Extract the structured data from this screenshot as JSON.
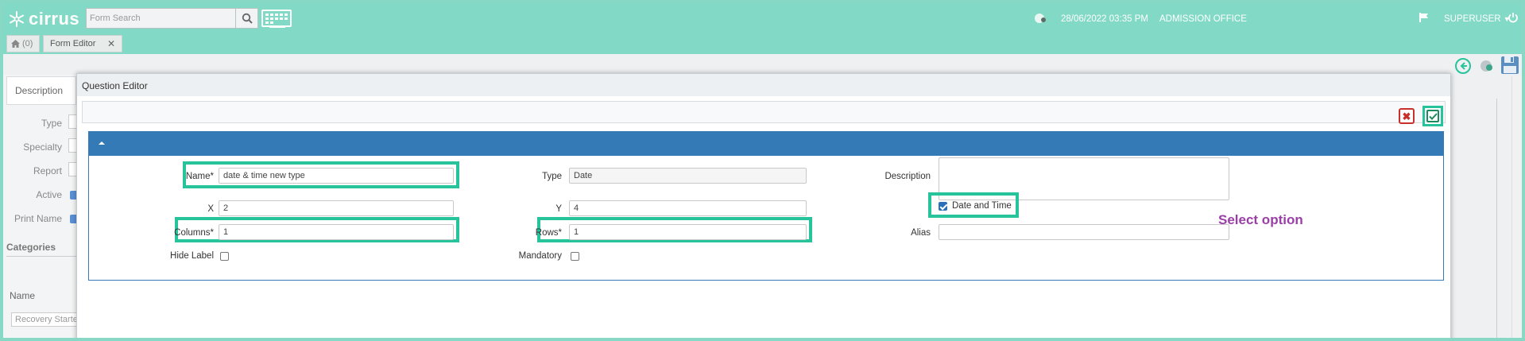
{
  "app": {
    "logo_text": "cirrus",
    "search_placeholder": "Form Search",
    "datetime": "28/06/2022 03:35 PM",
    "office": "ADMISSION OFFICE",
    "user": "SUPERUSER"
  },
  "tabs": {
    "home_count": "(0)",
    "form_editor": "Form Editor",
    "close_glyph": "✕"
  },
  "background_form": {
    "description_tab": "Description",
    "labels": [
      "Type",
      "Specialty",
      "Report",
      "Active",
      "Print Name"
    ],
    "categories_heading": "Categories",
    "name_header": "Name",
    "first_row": "Recovery Started"
  },
  "modal": {
    "title": "Question Editor",
    "close_glyph": "✖",
    "fields": {
      "name_label": "Name*",
      "name_value": "date & time new type",
      "type_label": "Type",
      "type_value": "Date",
      "description_label": "Description",
      "x_label": "X",
      "x_value": "2",
      "y_label": "Y",
      "y_value": "4",
      "date_time_label": "Date and Time",
      "columns_label": "Columns*",
      "columns_value": "1",
      "rows_label": "Rows*",
      "rows_value": "1",
      "alias_label": "Alias",
      "hide_label_label": "Hide Label",
      "mandatory_label": "Mandatory"
    },
    "annotation": "Select option"
  },
  "colors": {
    "topbar": "#82dac6",
    "section_header": "#337ab7",
    "highlight": "#27c39b",
    "annotation": "#9b3ea8",
    "close_red": "#c9302c"
  }
}
